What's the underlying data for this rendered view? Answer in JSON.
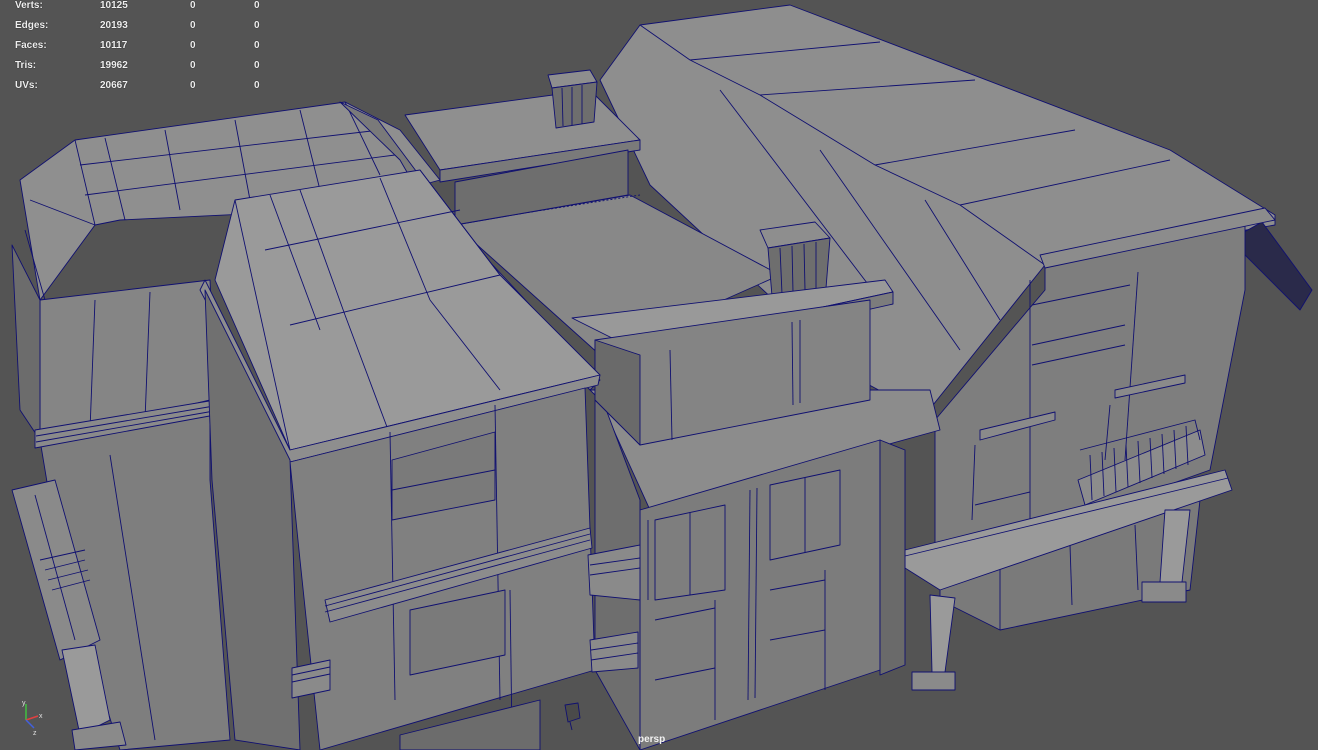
{
  "hud": {
    "rows": [
      {
        "label": "Verts:",
        "values": [
          "10125",
          "0",
          "0"
        ]
      },
      {
        "label": "Edges:",
        "values": [
          "20193",
          "0",
          "0"
        ]
      },
      {
        "label": "Faces:",
        "values": [
          "10117",
          "0",
          "0"
        ]
      },
      {
        "label": "Tris:",
        "values": [
          "19962",
          "0",
          "0"
        ]
      },
      {
        "label": "UVs:",
        "values": [
          "20667",
          "0",
          "0"
        ]
      }
    ]
  },
  "viewport": {
    "camera": "persp",
    "background_color": "#545454",
    "wireframe_color": "#101070"
  },
  "axis_gizmo": {
    "x": "x",
    "y": "y",
    "z": "z"
  },
  "model": {
    "display_mode": "shaded-wireframe",
    "icon": "house-model"
  }
}
